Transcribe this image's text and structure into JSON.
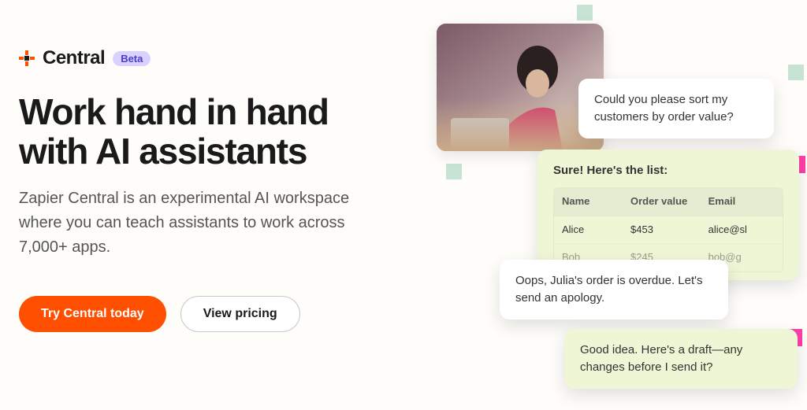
{
  "brand": {
    "name": "Central",
    "badge": "Beta",
    "logo_color_primary": "#ff4f00",
    "logo_color_secondary": "#1a1a1a"
  },
  "hero": {
    "headline": "Work hand in hand with AI assistants",
    "subhead": "Zapier Central is an experimental AI workspace where you can teach assistants to work across 7,000+ apps."
  },
  "cta": {
    "primary_label": "Try Central today",
    "secondary_label": "View pricing"
  },
  "chat": {
    "user1": "Could you please sort my customers by order value?",
    "ai1_title": "Sure! Here's the list:",
    "ai1_table": {
      "columns": [
        "Name",
        "Order value",
        "Email"
      ],
      "rows": [
        {
          "name": "Alice",
          "order_value": "$453",
          "email": "alice@sl"
        },
        {
          "name": "Bob",
          "order_value": "$245",
          "email": "bob@g"
        }
      ]
    },
    "user2": "Oops, Julia's order is overdue. Let's send an apology.",
    "ai2": "Good idea. Here's a draft—any changes before I send it?"
  },
  "colors": {
    "accent_orange": "#ff4f00",
    "badge_bg": "#d9d1ff",
    "badge_fg": "#4a3cc9",
    "ai_bubble_bg": "#eef6d6",
    "deco_green": "#c6e3d3",
    "deco_pink": "#ff3ea8"
  }
}
